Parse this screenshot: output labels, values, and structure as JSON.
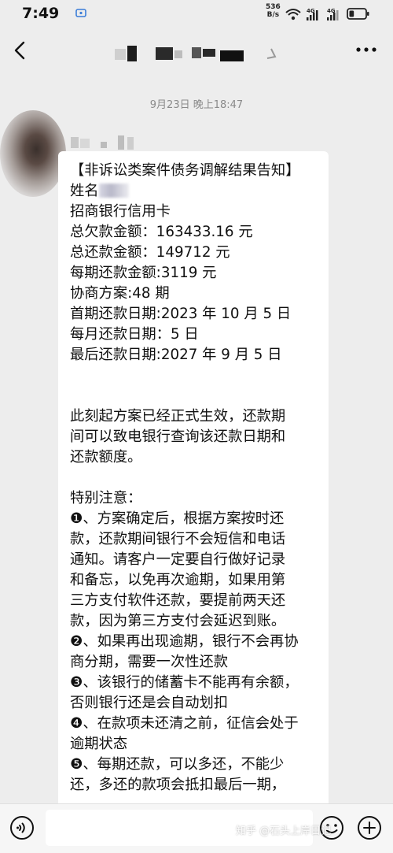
{
  "status_bar": {
    "time": "7:49",
    "net_speed_value": "536",
    "net_speed_unit": "B/s",
    "battery_level": 0.3,
    "icons": [
      "wifi-icon",
      "signal-4g-icon",
      "signal-4g-icon",
      "battery-icon"
    ]
  },
  "header": {
    "back_icon": "chevron-left-icon",
    "more_icon": "ellipsis-icon"
  },
  "chat": {
    "timestamp": "9月23日 晚上18:47",
    "message_lines": [
      "【非诉讼类案件债务调解结果告知】",
      "姓名",
      "招商银行信用卡",
      "总欠款金额：163433.16 元",
      "总还款金额：149712 元",
      "每期还款金额:3119 元",
      "协商方案:48 期",
      "首期还款日期:2023 年 10 月 5 日",
      "每月还款日期：5 日",
      "最后还款日期:2027 年 9 月 5 日",
      "",
      "",
      "此刻起方案已经正式生效，还款期",
      "间可以致电银行查询该还款日期和",
      "还款额度。",
      "",
      "特别注意：",
      "❶、方案确定后，根据方案按时还",
      "款，还款期间银行不会短信和电话",
      "通知。请客户一定要自行做好记录",
      "和备忘，以免再次逾期，如果用第",
      "三方支付软件还款，要提前两天还",
      "款，因为第三方支付会延迟到账。",
      "❷、如果再出现逾期，银行不会再协",
      "商分期，需要一次性还款",
      "❸、该银行的储蓄卡不能再有余额，",
      "否则银行还是会自动划扣",
      "❹、在款项未还清之前，征信会处于",
      "逾期状态",
      "❺、每期还款，可以多还，不能少",
      "还，多还的款项会抵扣最后一期，"
    ]
  },
  "input_bar": {
    "voice_icon": "voice-icon",
    "emoji_icon": "emoji-icon",
    "plus_icon": "plus-icon"
  },
  "watermark": "知乎 @石头上岸日记"
}
